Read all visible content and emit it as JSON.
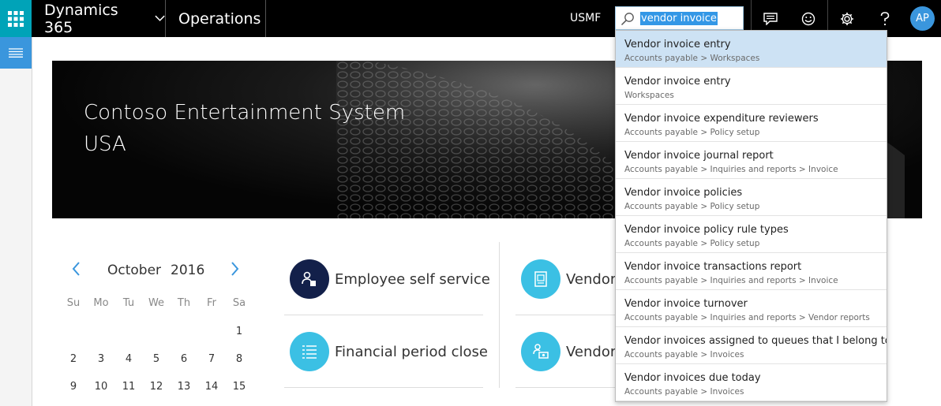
{
  "header": {
    "product": "Dynamics 365",
    "app": "Operations",
    "company": "USMF",
    "avatar_initials": "AP",
    "accent_color": "#00a3b8"
  },
  "search": {
    "value": "vendor invoice"
  },
  "banner": {
    "line1": "Contoso Entertainment System",
    "line2": "USA"
  },
  "calendar": {
    "month": "October",
    "year": "2016",
    "weekdays": [
      "Su",
      "Mo",
      "Tu",
      "We",
      "Th",
      "Fr",
      "Sa"
    ],
    "weeks": [
      [
        "",
        "",
        "",
        "",
        "",
        "",
        "1"
      ],
      [
        "2",
        "3",
        "4",
        "5",
        "6",
        "7",
        "8"
      ],
      [
        "9",
        "10",
        "11",
        "12",
        "13",
        "14",
        "15"
      ]
    ]
  },
  "tiles": [
    {
      "label": "Employee self service",
      "icon": "employee-icon",
      "color": "#13204a"
    },
    {
      "label": "Financial period close",
      "icon": "list-icon",
      "color": "#3bc0e4"
    },
    {
      "label": "Vendor",
      "icon": "document-icon",
      "color": "#3bc0e4"
    },
    {
      "label": "Vendor",
      "icon": "vendor-payment-icon",
      "color": "#3bc0e4"
    }
  ],
  "results": [
    {
      "title": "Vendor invoice entry",
      "path": "Accounts payable > Workspaces"
    },
    {
      "title": "Vendor invoice entry",
      "path": "Workspaces"
    },
    {
      "title": "Vendor invoice expenditure reviewers",
      "path": "Accounts payable > Policy setup"
    },
    {
      "title": "Vendor invoice journal report",
      "path": "Accounts payable > Inquiries and reports > Invoice"
    },
    {
      "title": "Vendor invoice policies",
      "path": "Accounts payable > Policy setup"
    },
    {
      "title": "Vendor invoice policy rule types",
      "path": "Accounts payable > Policy setup"
    },
    {
      "title": "Vendor invoice transactions report",
      "path": "Accounts payable > Inquiries and reports > Invoice"
    },
    {
      "title": "Vendor invoice turnover",
      "path": "Accounts payable > Inquiries and reports > Vendor reports"
    },
    {
      "title": "Vendor invoices assigned to queues that I belong to",
      "path": "Accounts payable > Invoices"
    },
    {
      "title": "Vendor invoices due today",
      "path": "Accounts payable > Invoices"
    }
  ]
}
